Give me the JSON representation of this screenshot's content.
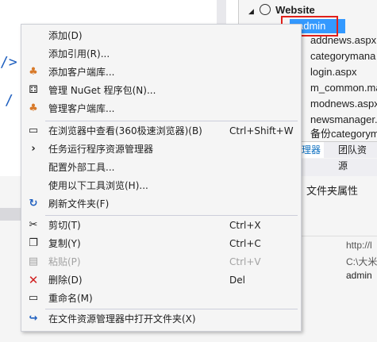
{
  "solution_explorer": {
    "project": "Website",
    "items": [
      "admin",
      "addnews.aspx",
      "categorymana",
      "login.aspx",
      "m_common.ma",
      "modnews.aspx",
      "newsmanager.",
      "备份categorym"
    ],
    "tabs": [
      "理器",
      "团队资源"
    ]
  },
  "properties": {
    "title": "文件夹属性",
    "values": [
      "http://l",
      "C:\\大米",
      "admin"
    ]
  },
  "menu": {
    "items": [
      {
        "label": "添加(D)",
        "shortcut": "",
        "icon": "none"
      },
      {
        "label": "添加引用(R)...",
        "shortcut": "",
        "icon": "none"
      },
      {
        "label": "添加客户端库...",
        "shortcut": "",
        "icon": "palette-icon"
      },
      {
        "label": "管理 NuGet 程序包(N)...",
        "shortcut": "",
        "icon": "nuget-icon"
      },
      {
        "label": "管理客户端库...",
        "shortcut": "",
        "icon": "palette-icon"
      },
      {
        "label": "在浏览器中查看(360极速浏览器)(B)",
        "shortcut": "Ctrl+Shift+W",
        "icon": "browser-icon"
      },
      {
        "label": "任务运行程序资源管理器",
        "shortcut": "",
        "icon": "chevron-right-icon"
      },
      {
        "label": "配置外部工具...",
        "shortcut": "",
        "icon": "none"
      },
      {
        "label": "使用以下工具浏览(H)...",
        "shortcut": "",
        "icon": "none"
      },
      {
        "label": "刷新文件夹(F)",
        "shortcut": "",
        "icon": "refresh-icon"
      },
      {
        "label": "剪切(T)",
        "shortcut": "Ctrl+X",
        "icon": "scissors-icon"
      },
      {
        "label": "复制(Y)",
        "shortcut": "Ctrl+C",
        "icon": "copy-icon"
      },
      {
        "label": "粘贴(P)",
        "shortcut": "Ctrl+V",
        "icon": "paste-icon",
        "disabled": true
      },
      {
        "label": "删除(D)",
        "shortcut": "Del",
        "icon": "delete-icon"
      },
      {
        "label": "重命名(M)",
        "shortcut": "",
        "icon": "rename-icon"
      },
      {
        "label": "在文件资源管理器中打开文件夹(X)",
        "shortcut": "",
        "icon": "open-folder-icon"
      }
    ]
  },
  "colors": {
    "highlight": "#e0201a",
    "selection": "#3399ff",
    "accent": "#1f5fbf"
  }
}
